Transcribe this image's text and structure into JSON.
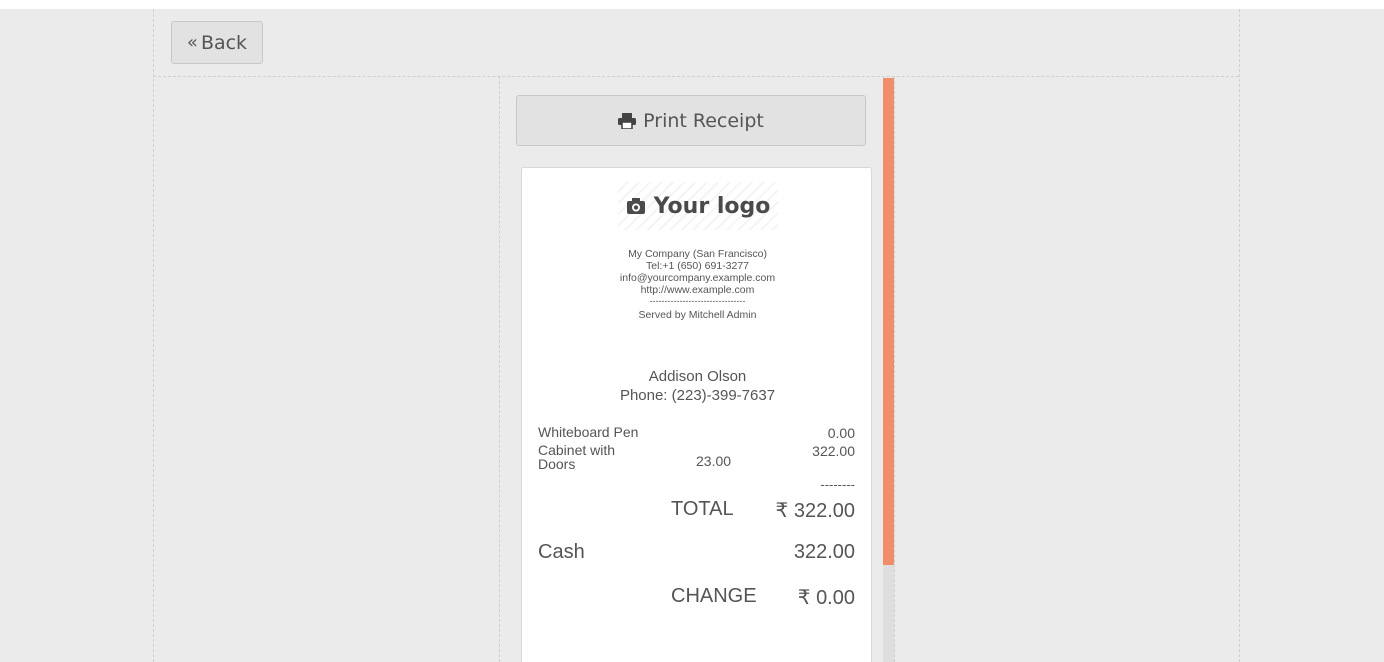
{
  "nav": {
    "back_label": "Back"
  },
  "actions": {
    "print_label": "Print Receipt"
  },
  "receipt": {
    "logo_text": "Your logo",
    "company": {
      "name": "My Company (San Francisco)",
      "tel": "Tel:+1 (650) 691-3277",
      "email": "info@yourcompany.example.com",
      "website": "http://www.example.com",
      "divider": "--------------------------------",
      "served_by": "Served by Mitchell Admin"
    },
    "customer": {
      "name": "Addison Olson",
      "phone": "Phone: (223)-399-7637"
    },
    "lines": [
      {
        "product": "Whiteboard Pen",
        "qty": "",
        "price": "0.00"
      },
      {
        "product": "Cabinet with Doors",
        "qty": "23.00",
        "price": "322.00"
      }
    ],
    "separator": "--------",
    "total_label": "TOTAL",
    "total_value": "₹ 322.00",
    "payment_method": "Cash",
    "payment_amount": "322.00",
    "change_label": "CHANGE",
    "change_value": "₹ 0.00"
  },
  "colors": {
    "scrollbar_thumb": "#f08d6a",
    "background": "#ebebeb"
  }
}
